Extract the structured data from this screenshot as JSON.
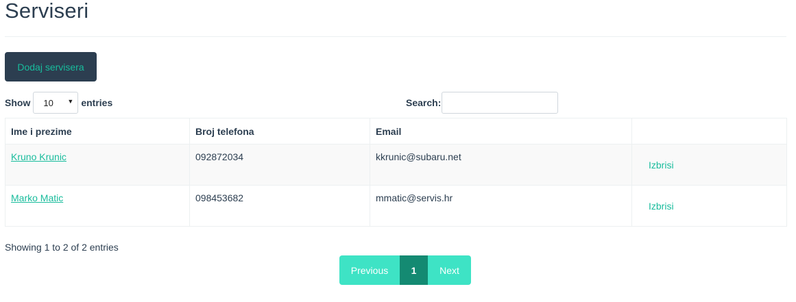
{
  "page": {
    "title": "Serviseri"
  },
  "toolbar": {
    "add_label": "Dodaj servisera"
  },
  "length_control": {
    "show_label": "Show",
    "selected": "10",
    "entries_label": "entries"
  },
  "search": {
    "label": "Search:",
    "value": ""
  },
  "table": {
    "headers": [
      "Ime i prezime",
      "Broj telefona",
      "Email",
      ""
    ],
    "rows": [
      {
        "name": "Kruno Krunic",
        "phone": "092872034",
        "email": "kkrunic@subaru.net",
        "action": "Izbrisi"
      },
      {
        "name": "Marko Matic",
        "phone": "098453682",
        "email": "mmatic@servis.hr",
        "action": "Izbrisi"
      }
    ]
  },
  "info": {
    "text": "Showing 1 to 2 of 2 entries"
  },
  "pagination": {
    "previous": "Previous",
    "current": "1",
    "next": "Next"
  },
  "colors": {
    "primary": "#2c3e50",
    "accent": "#18bc9c",
    "pager_bg": "#3ee3c5",
    "pager_active": "#148a72"
  }
}
